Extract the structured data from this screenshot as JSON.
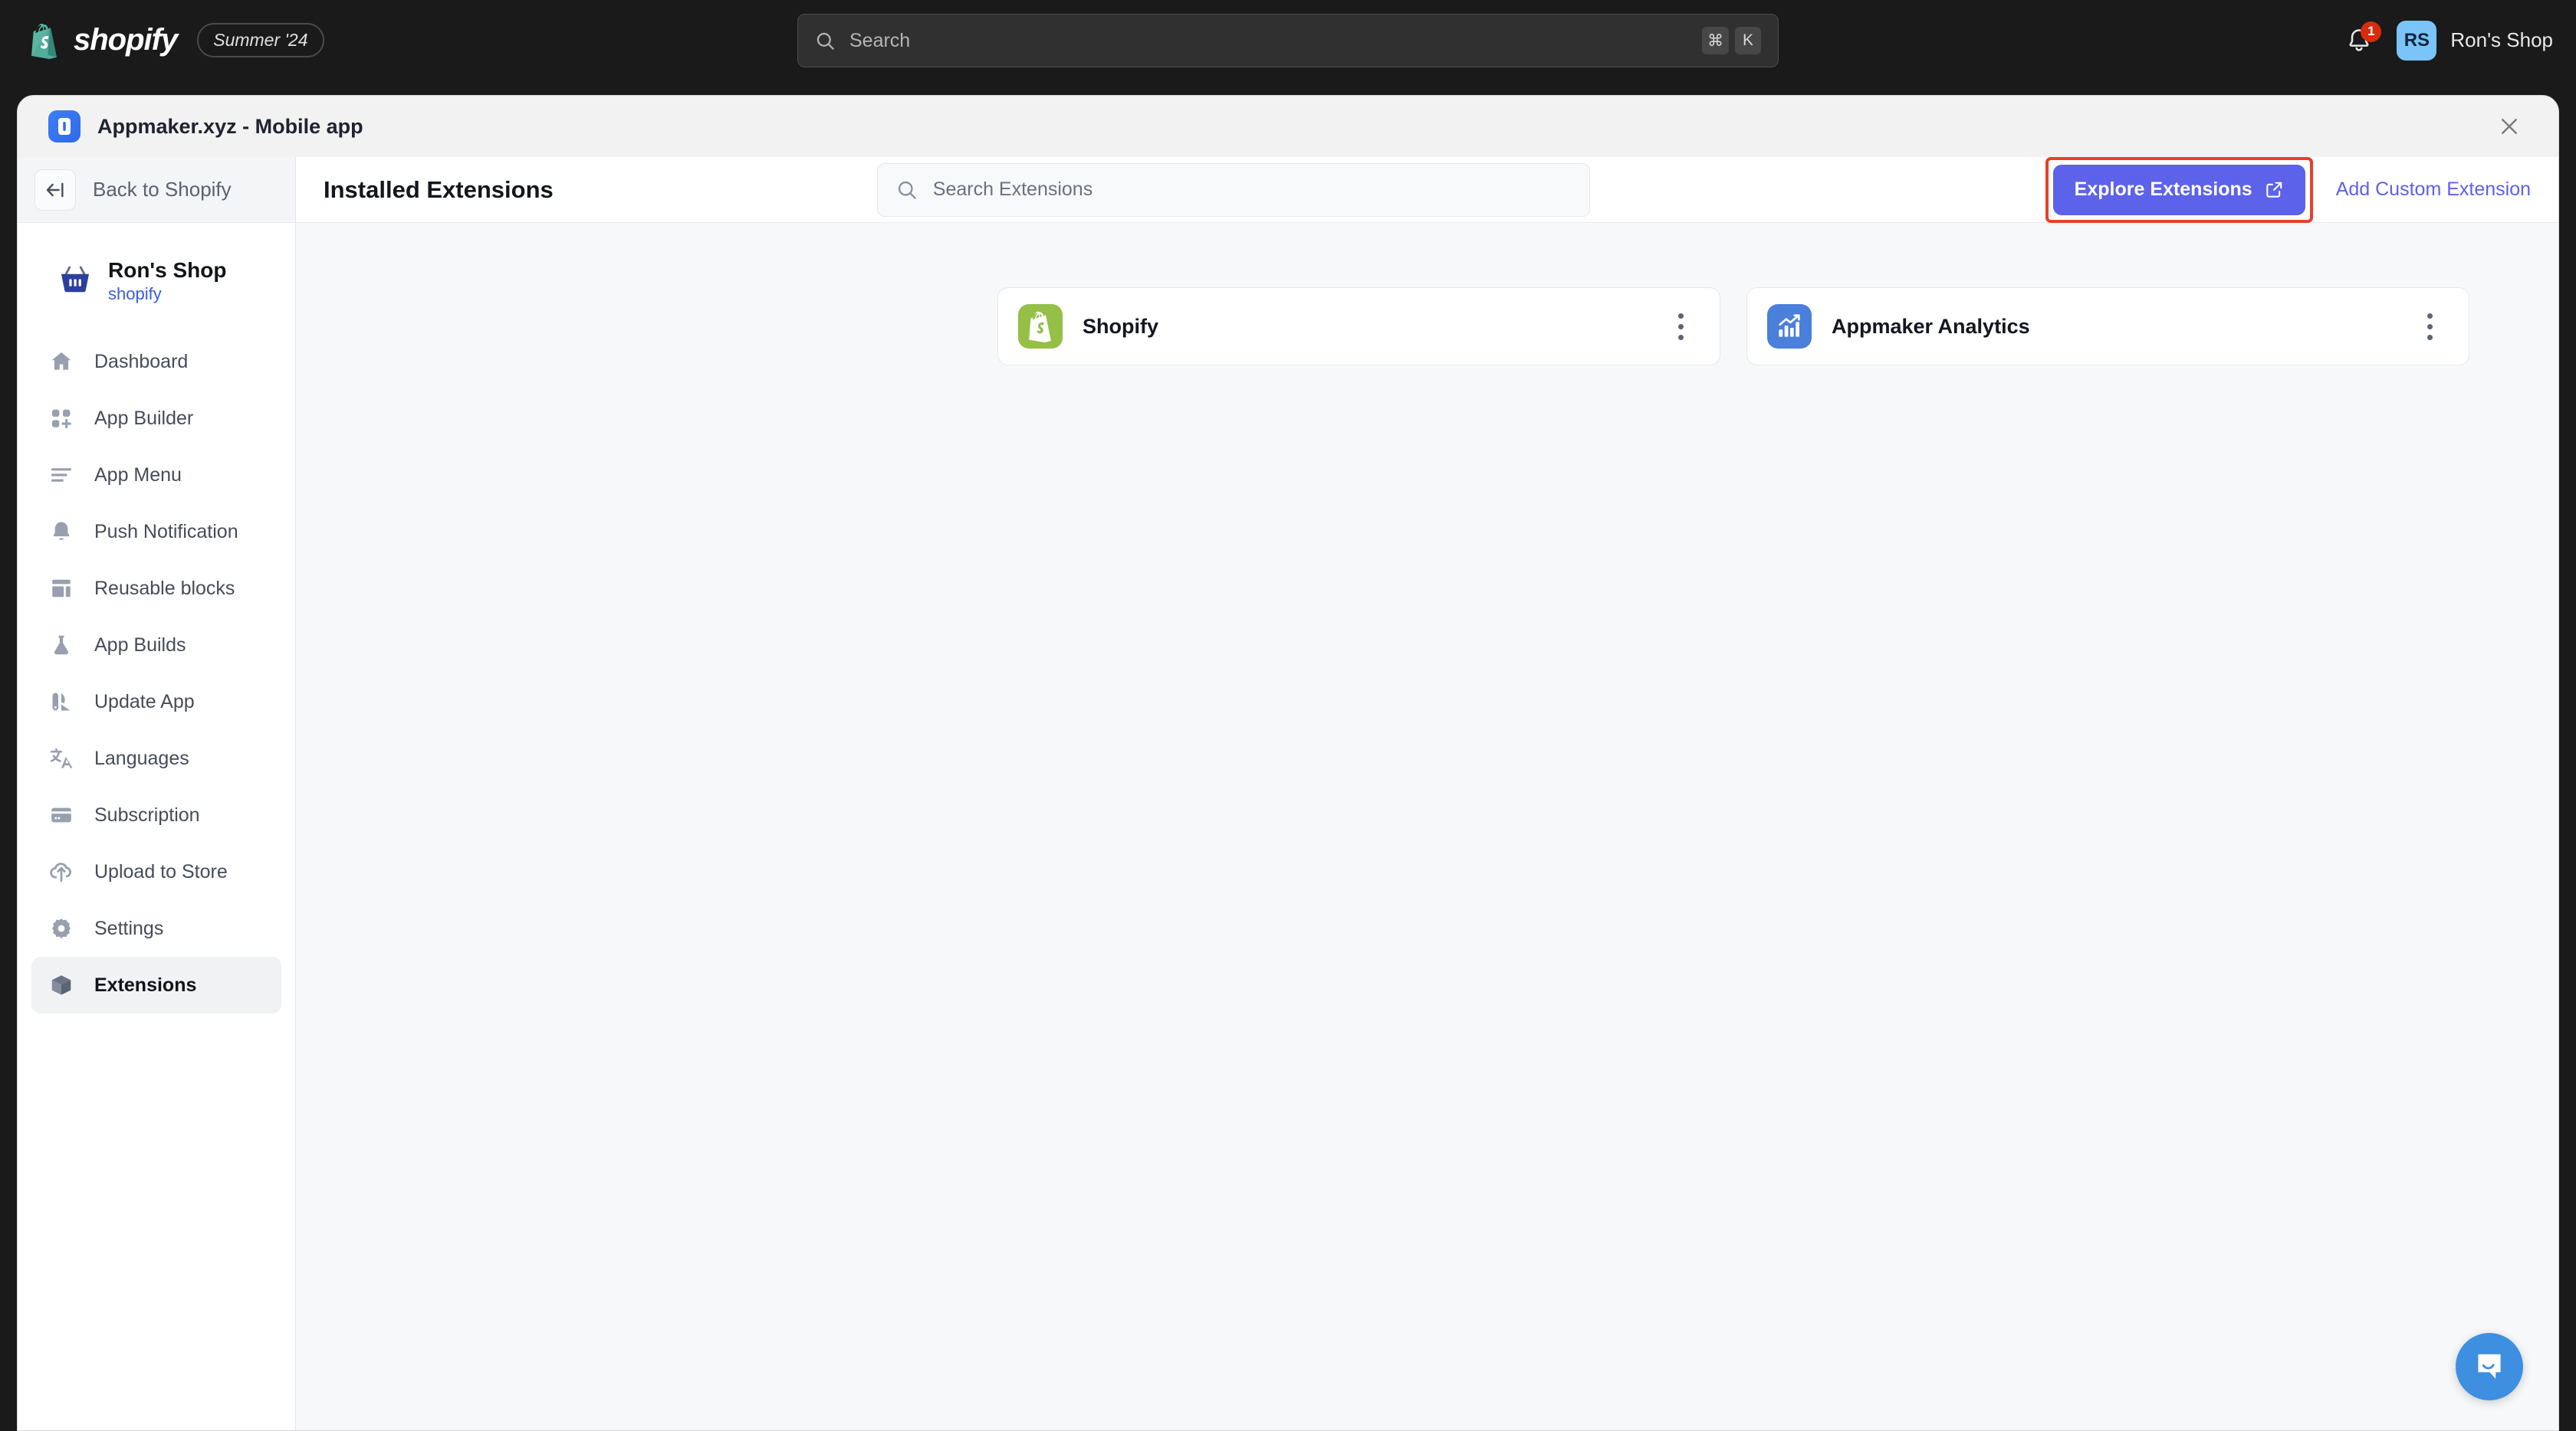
{
  "topbar": {
    "brand_name": "shopify",
    "season_badge": "Summer '24",
    "logo_icon": "shopify-bag-icon",
    "search": {
      "placeholder": "Search",
      "icon": "search-icon",
      "kbd": [
        "⌘",
        "K"
      ]
    },
    "notifications": {
      "icon": "bell-icon",
      "count": "1"
    },
    "user": {
      "initials": "RS",
      "name": "Ron's Shop"
    }
  },
  "modal": {
    "icon": "appmaker-app-icon",
    "title": "Appmaker.xyz - Mobile app",
    "close_icon": "close-icon"
  },
  "sidebar": {
    "back": {
      "label": "Back to Shopify",
      "icon": "arrow-left-to-bar-icon"
    },
    "store": {
      "icon": "shopping-basket-icon",
      "name": "Ron's Shop",
      "platform": "shopify"
    },
    "items": [
      {
        "label": "Dashboard",
        "icon": "home-icon",
        "active": false
      },
      {
        "label": "App Builder",
        "icon": "grid-plus-icon",
        "active": false
      },
      {
        "label": "App Menu",
        "icon": "menu-lines-icon",
        "active": false
      },
      {
        "label": "Push Notification",
        "icon": "bell-icon",
        "active": false
      },
      {
        "label": "Reusable blocks",
        "icon": "layout-blocks-icon",
        "active": false
      },
      {
        "label": "App Builds",
        "icon": "flask-icon",
        "active": false
      },
      {
        "label": "Update App",
        "icon": "update-app-icon",
        "active": false
      },
      {
        "label": "Languages",
        "icon": "translate-icon",
        "active": false
      },
      {
        "label": "Subscription",
        "icon": "credit-card-icon",
        "active": false
      },
      {
        "label": "Upload to Store",
        "icon": "cloud-upload-icon",
        "active": false
      },
      {
        "label": "Settings",
        "icon": "gear-icon",
        "active": false
      },
      {
        "label": "Extensions",
        "icon": "cube-icon",
        "active": true
      }
    ]
  },
  "main": {
    "page_title": "Installed Extensions",
    "search": {
      "placeholder": "Search Extensions",
      "icon": "search-icon"
    },
    "explore_button": {
      "label": "Explore Extensions",
      "icon": "external-link-icon",
      "highlighted": true
    },
    "add_custom_link": "Add Custom Extension",
    "extensions": [
      {
        "name": "Shopify",
        "icon": "shopify-bag-icon",
        "icon_color": "#95bf47",
        "menu_icon": "more-vertical-icon"
      },
      {
        "name": "Appmaker Analytics",
        "icon": "bar-chart-icon",
        "icon_color": "#4a7fdb",
        "menu_icon": "more-vertical-icon"
      }
    ]
  },
  "chat": {
    "icon": "chat-bubble-icon",
    "color": "#3f8fe0"
  },
  "colors": {
    "topbar_bg": "#1a1a1a",
    "accent_purple": "#5c62ea",
    "highlight_red": "#e8402a",
    "content_bg": "#f7f8fa",
    "shopify_green": "#95bf47",
    "analytics_blue": "#4a7fdb",
    "store_link_blue": "#3b5bdb",
    "avatar_blue": "#7ac4f7",
    "badge_red": "#d72c0d"
  }
}
